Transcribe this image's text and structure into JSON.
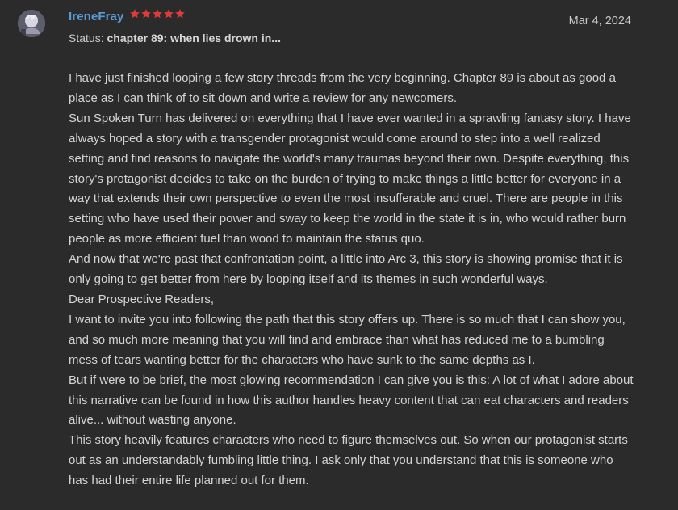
{
  "review": {
    "username": "IreneFray",
    "rating": 5,
    "rating_color": "#e03a3a",
    "date": "Mar 4, 2024",
    "status_label": "Status:",
    "status_value": "chapter 89: when lies drown in...",
    "paragraphs": [
      "I have just finished looping a few story threads from the very beginning. Chapter 89 is about as good a place as I can think of to sit down and write a review for any newcomers.",
      "Sun Spoken Turn has delivered on everything that I have ever wanted in a sprawling fantasy story. I have always hoped a story with a transgender protagonist would come around to step into a well realized setting and find reasons to navigate the world's many traumas beyond their own. Despite everything, this story's protagonist decides to take on the burden of trying to make things a little better for everyone in a way that extends their own perspective to even the most insufferable and cruel. There are people in this setting who have used their power and sway to keep the world in the state it is in, who would rather burn people as more efficient fuel than wood to maintain the status quo.",
      "And now that we're past that confrontation point, a little into Arc 3, this story is showing promise that it is only going to get better from here by looping itself and its themes in such wonderful ways.",
      "Dear Prospective Readers,",
      "I want to invite you into following the path that this story offers up. There is so much that I can show you, and so much more meaning that you will find and embrace than what has reduced me to a bumbling mess of tears wanting better for the characters who have sunk to the same depths as I.",
      "But if were to be brief, the most glowing recommendation I can give you is this: A lot of what I adore about this narrative can be found in how this author handles heavy content that can eat characters and readers alive... without wasting anyone.",
      "This story heavily features characters who need to figure themselves out. So when our protagonist starts out as an understandably fumbling little thing. I ask only that you understand that this is someone who has had their entire life planned out for them."
    ]
  }
}
